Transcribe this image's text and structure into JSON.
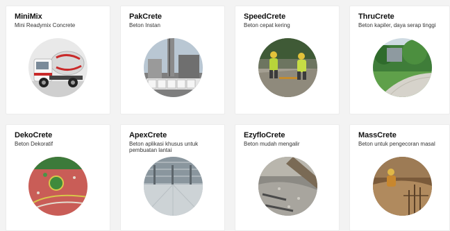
{
  "products": [
    {
      "title": "MiniMix",
      "subtitle": "Mini Readymix Concrete",
      "image": "mini-readymix-truck"
    },
    {
      "title": "PakCrete",
      "subtitle": "Beton Instan",
      "image": "cement-bag-warehouse"
    },
    {
      "title": "SpeedCrete",
      "subtitle": "Beton cepat kering",
      "image": "workers-pouring-concrete"
    },
    {
      "title": "ThruCrete",
      "subtitle": "Beton kapiler, daya serap tinggi",
      "image": "permeable-pavement-park"
    },
    {
      "title": "DekoCrete",
      "subtitle": "Beton Dekoratif",
      "image": "decorative-red-pavement"
    },
    {
      "title": "ApexCrete",
      "subtitle": "Beton aplikasi khusus untuk pembuatan lantai",
      "image": "industrial-floor-hall"
    },
    {
      "title": "EzyfloCrete",
      "subtitle": "Beton mudah mengalir",
      "image": "flowing-concrete-chute"
    },
    {
      "title": "MassCrete",
      "subtitle": "Beton untuk pengecoran masal",
      "image": "mass-concrete-pour"
    }
  ]
}
